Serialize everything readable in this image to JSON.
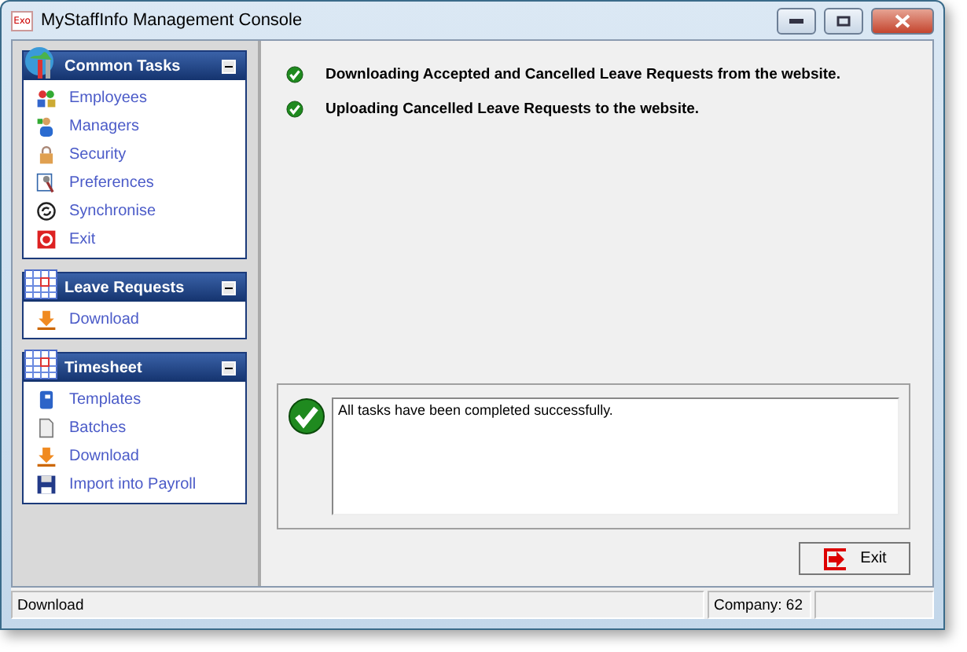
{
  "window": {
    "title": "MyStaffInfo Management Console",
    "app_icon": "Exo"
  },
  "sidebar": {
    "groups": [
      {
        "title": "Common Tasks",
        "kind": "tools",
        "items": [
          {
            "label": "Employees",
            "kind": "people"
          },
          {
            "label": "Managers",
            "kind": "person"
          },
          {
            "label": "Security",
            "kind": "lock"
          },
          {
            "label": "Preferences",
            "kind": "prefs"
          },
          {
            "label": "Synchronise",
            "kind": "sync"
          },
          {
            "label": "Exit",
            "kind": "exit"
          }
        ]
      },
      {
        "title": "Leave Requests",
        "kind": "calendar",
        "items": [
          {
            "label": "Download",
            "kind": "download"
          }
        ]
      },
      {
        "title": "Timesheet",
        "kind": "calendar",
        "items": [
          {
            "label": "Templates",
            "kind": "book"
          },
          {
            "label": "Batches",
            "kind": "page"
          },
          {
            "label": "Download",
            "kind": "download"
          },
          {
            "label": "Import into Payroll",
            "kind": "disk"
          }
        ]
      }
    ]
  },
  "tasks": [
    {
      "text": "Downloading Accepted and Cancelled Leave Requests from the website.",
      "done": true
    },
    {
      "text": "Uploading Cancelled Leave Requests to the website.",
      "done": true
    }
  ],
  "result": {
    "message": "All tasks have been completed successfully.",
    "success": true
  },
  "exit_button": "Exit",
  "status_bar": {
    "message": "Download",
    "company": "Company: 62"
  }
}
